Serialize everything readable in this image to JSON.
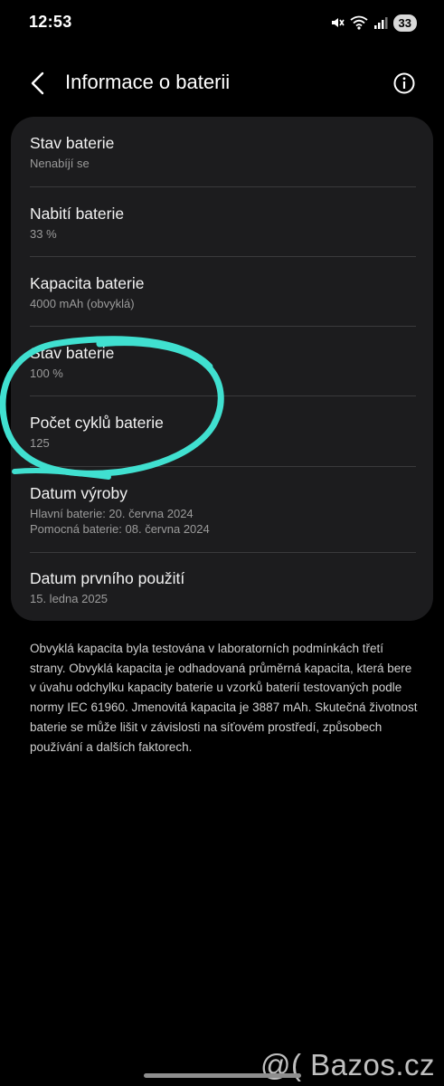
{
  "status_bar": {
    "time": "12:53",
    "battery": "33",
    "icons": [
      "mute-icon",
      "wifi-icon",
      "signal-icon"
    ]
  },
  "header": {
    "title": "Informace o baterii",
    "back_icon": "chevron-left-icon",
    "info_icon": "info-icon"
  },
  "rows": [
    {
      "title": "Stav baterie",
      "subtitle": "Nenabíjí se"
    },
    {
      "title": "Nabití baterie",
      "subtitle": "33 %"
    },
    {
      "title": "Kapacita baterie",
      "subtitle": "4000 mAh (obvyklá)"
    },
    {
      "title": "Stav baterie",
      "subtitle": "100 %"
    },
    {
      "title": "Počet cyklů baterie",
      "subtitle": "125"
    },
    {
      "title": "Datum výroby",
      "subtitle": "Hlavní baterie: 20. června 2024",
      "subtitle2": "Pomocná baterie: 08. června 2024"
    },
    {
      "title": "Datum prvního použití",
      "subtitle": "15. ledna 2025"
    }
  ],
  "description": "Obvyklá kapacita byla testována v laboratorních podmínkách třetí strany. Obvyklá kapacita je odhadovaná průměrná kapacita, která bere v úvahu odchylku kapacity baterie u vzorků baterií testovaných podle normy IEC 61960. Jmenovitá kapacita je 3887 mAh. Skutečná životnost baterie se může lišit v závislosti na síťovém prostředí, způsobech používání a dalších faktorech.",
  "watermark": "@( Bazos.cz",
  "colors": {
    "background": "#000000",
    "card": "#1c1c1e",
    "annotation": "#40e0d0"
  }
}
